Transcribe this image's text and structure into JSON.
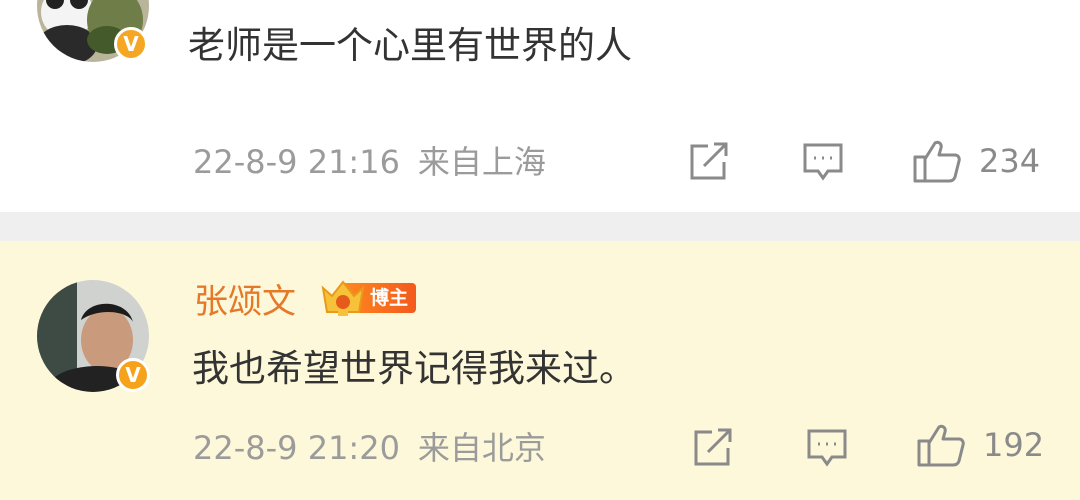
{
  "comments": [
    {
      "author": "",
      "text": "老师是一个心里有世界的人",
      "time": "22-8-9 21:16",
      "location": "来自上海",
      "likes": "234",
      "verify_mark": "V",
      "verify_color": "#f5a623"
    },
    {
      "author": "张颂文",
      "badge": "博主",
      "text": "我也希望世界记得我来过。",
      "time": "22-8-9 21:20",
      "location": "来自北京",
      "likes": "192",
      "verify_mark": "V",
      "verify_color": "#f7a21b"
    }
  ],
  "icons": [
    "share-icon",
    "comment-icon",
    "like-icon",
    "crown-icon"
  ],
  "colors": {
    "highlight_bg": "#fdf8d9",
    "divider": "#efefef",
    "username": "#e4792a",
    "meta_text": "#9b9b9b"
  }
}
